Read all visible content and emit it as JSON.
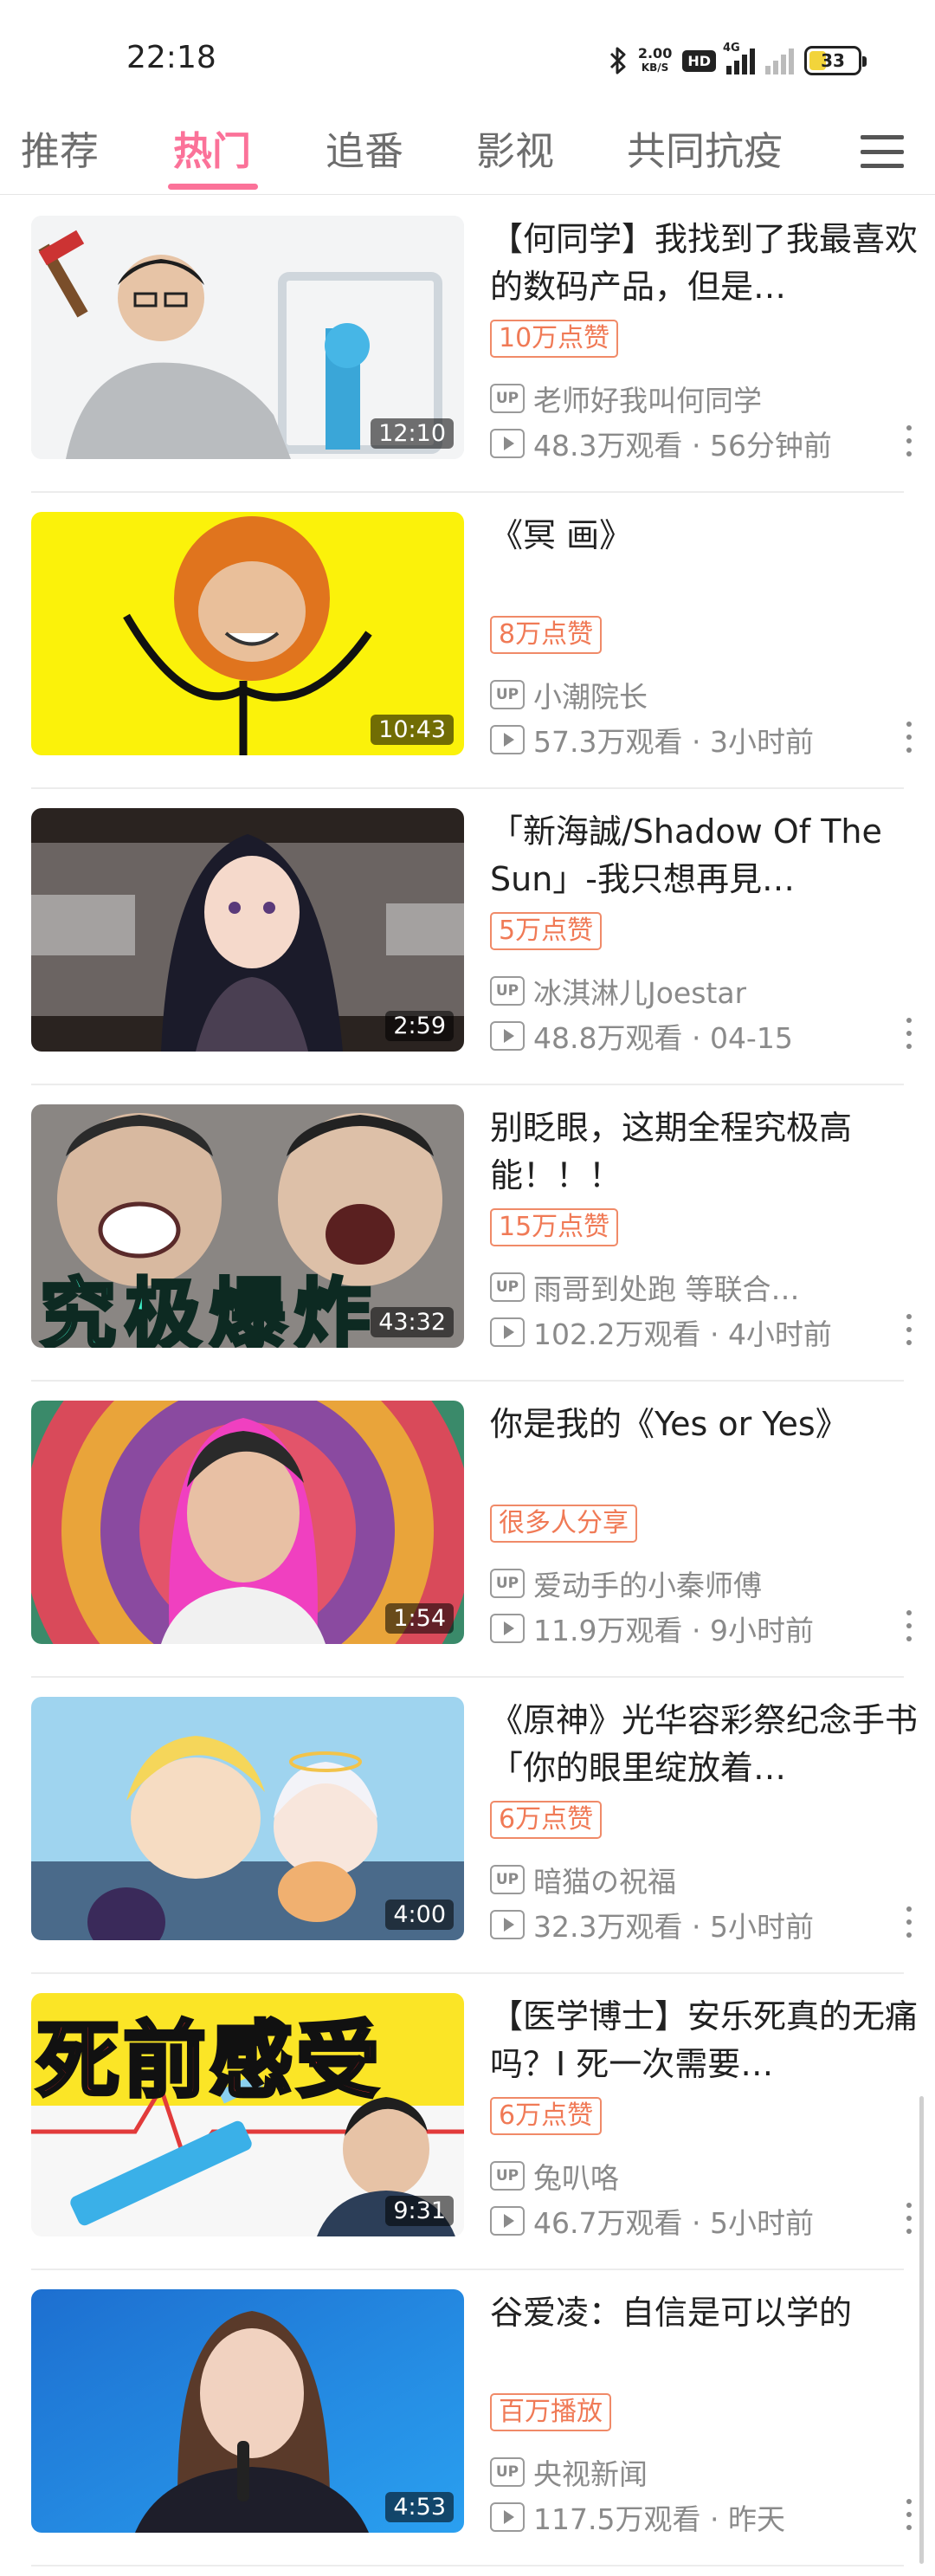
{
  "status_bar": {
    "time": "22:18",
    "net_speed": "2.00",
    "net_unit": "KB/S",
    "hd_label": "HD",
    "network_type": "4G",
    "battery": "33",
    "icons": [
      "bluetooth-icon",
      "hd-icon",
      "signal-icon",
      "battery-icon"
    ]
  },
  "tabs": [
    {
      "label": "推荐",
      "active": false
    },
    {
      "label": "热门",
      "active": true
    },
    {
      "label": "追番",
      "active": false
    },
    {
      "label": "影视",
      "active": false
    },
    {
      "label": "共同抗疫",
      "active": false
    }
  ],
  "accent_color": "#fb7299",
  "badge_color": "#f07a56",
  "feed": [
    {
      "title": "【何同学】我找到了我最喜欢的数码产品，但是…",
      "duration": "12:10",
      "badge": "10万点赞",
      "uploader": "老师好我叫何同学",
      "stats": "48.3万观看 · 56分钟前"
    },
    {
      "title": "《冥 画》",
      "duration": "10:43",
      "badge": "8万点赞",
      "uploader": "小潮院长",
      "stats": "57.3万观看 · 3小时前"
    },
    {
      "title": "「新海誠/Shadow Of The Sun」-我只想再見…",
      "duration": "2:59",
      "badge": "5万点赞",
      "uploader": "冰淇淋儿Joestar",
      "stats": "48.8万观看 · 04-15"
    },
    {
      "title": "别眨眼，这期全程究极高能！！！",
      "duration": "43:32",
      "badge": "15万点赞",
      "uploader": "雨哥到处跑 等联合…",
      "stats": "102.2万观看 · 4小时前",
      "thumb_text": "究极爆炸"
    },
    {
      "title": "你是我的《Yes or Yes》",
      "duration": "1:54",
      "badge": "很多人分享",
      "uploader": "爱动手的小秦师傅",
      "stats": "11.9万观看 · 9小时前"
    },
    {
      "title": "《原神》光华容彩祭纪念手书「你的眼里绽放着…",
      "duration": "4:00",
      "badge": "6万点赞",
      "uploader": "暗猫の祝福",
      "stats": "32.3万观看 · 5小时前"
    },
    {
      "title": "【医学博士】安乐死真的无痛吗？I 死一次需要…",
      "duration": "9:31",
      "badge": "6万点赞",
      "uploader": "兔叭咯",
      "stats": "46.7万观看 · 5小时前",
      "thumb_text": "死前感受"
    },
    {
      "title": "谷爱凌：自信是可以学的",
      "duration": "4:53",
      "badge": "百万播放",
      "uploader": "央视新闻",
      "stats": "117.5万观看 · 昨天"
    }
  ]
}
